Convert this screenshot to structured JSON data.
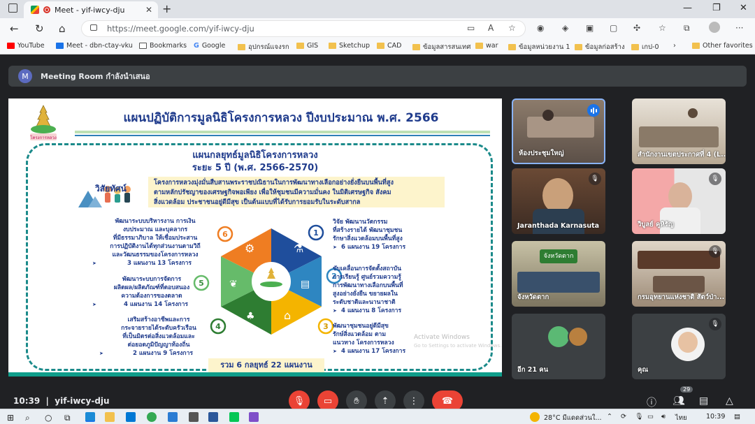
{
  "browser": {
    "tab_title": "Meet - yif-iwcy-dju",
    "new_tab": "+",
    "url": "https://meet.google.com/yif-iwcy-dju",
    "window_controls": [
      "—",
      "❐",
      "✕"
    ]
  },
  "bookmarks": [
    {
      "label": "YouTube",
      "kind": "youtube"
    },
    {
      "label": "Meet - dbn-ctay-vku",
      "kind": "meet"
    },
    {
      "label": "Bookmarks",
      "kind": "page"
    },
    {
      "label": "Google",
      "kind": "google"
    },
    {
      "label": "อุปกรณ์แจงรก",
      "kind": "folder"
    },
    {
      "label": "GIS",
      "kind": "folder"
    },
    {
      "label": "Sketchup",
      "kind": "folder"
    },
    {
      "label": "CAD",
      "kind": "folder"
    },
    {
      "label": "ข้อมูลสารสนเทศ",
      "kind": "folder"
    },
    {
      "label": "war",
      "kind": "folder"
    },
    {
      "label": "ข้อมูลหน่วยงาน 1",
      "kind": "folder"
    },
    {
      "label": "ข้อมูลก่อสร้าง",
      "kind": "folder"
    },
    {
      "label": "เกป-0",
      "kind": "folder"
    },
    {
      "label": "Other favorites",
      "kind": "folder"
    }
  ],
  "meeting": {
    "room_avatar": "M",
    "room_title": "Meeting Room กำลังนำเสนอ",
    "time": "10:39",
    "code": "yif-iwcy-dju",
    "participants_count": "29"
  },
  "slide": {
    "title": "แผนปฏิบัติการมูลนิธิโครงการหลวง ปีงบประมาณ พ.ศ. 2566",
    "logo_text": "โครงการหลวง",
    "subtitle1": "แผนกลยุทธ์มูลนิธิโครงการหลวง",
    "subtitle2": "ระยะ 5 ปี (พ.ศ. 2566-2570)",
    "vision_label": "วิสัยทัศน์",
    "vision_lines": [
      "โครงการหลวงมุ่งมั่นสืบสานพระราชปณิธานในการพัฒนาทางเลือกอย่างยั่งยืนบนพื้นที่สูง",
      "ตามหลักปรัชญาของเศรษฐกิจพอเพียง เพื่อให้ชุมชนมีความมั่นคง ในมิติเศรษฐกิจ สังคม",
      "สิ่งแวดล้อม ประชาชนอยู่ดีมีสุข เป็นต้นแบบที่ได้รับการยอมรับในระดับสากล"
    ],
    "strategies": [
      {
        "num": "1",
        "lines": [
          "วิจัย พัฒนานวัตกรรม",
          "ที่สร้างรายได้ พัฒนาชุมชน",
          "รักษาสิ่งแวดล้อมบนพื้นที่สูง"
        ],
        "note": "6 แผนงาน 19 โครงการ"
      },
      {
        "num": "2",
        "lines": [
          "ขับเคลื่อนการจัดตั้งสถาบัน",
          "การเรียนรู้ ศูนย์รวมความรู้",
          "การพัฒนาทางเลือกบนพื้นที่",
          "สูงอย่างยั่งยืน ขยายผลใน",
          "ระดับชาติและนานาชาติ"
        ],
        "note": "4 แผนงาน 8 โครงการ"
      },
      {
        "num": "3",
        "lines": [
          "พัฒนาชุมชนอยู่ดีมีสุข",
          "รักษ์สิ่งแวดล้อม ตาม",
          "แนวทาง โครงการหลวง"
        ],
        "note": "4 แผนงาน 17 โครงการ"
      },
      {
        "num": "4",
        "lines": [
          "เสริมสร้างอาชีพและการ",
          "กระจายรายได้ระดับครัวเรือน",
          "ที่เป็นมิตรต่อสิ่งแวดล้อมและ",
          "ต่อยอดภูมิปัญญาท้องถิ่น"
        ],
        "note": "2 แผนงาน 9 โครงการ"
      },
      {
        "num": "5",
        "lines": [
          "พัฒนาระบบการจัดการ",
          "ผลิตผล/ผลิตภัณฑ์ที่ตอบสนอง",
          "ความต้องการของตลาด"
        ],
        "note": "4 แผนงาน 14 โครงการ"
      },
      {
        "num": "6",
        "lines": [
          "พัฒนาระบบบริหารงาน การเงิน",
          "งบประมาณ และบุคลากร",
          "ที่มีธรรมาภิบาล ให้เชื่อมประสาน",
          "การปฏิบัติงานได้ทุกส่วนงานตามวิถี",
          "และวัฒนธรรมของโครงการหลวง"
        ],
        "note": "3 แผนงาน 13 โครงการ"
      }
    ],
    "total": "รวม 6 กลยุทธ์ 22 แผนงาน",
    "watermark1": "Activate Windows",
    "watermark2": "Go to Settings to activate Windows."
  },
  "tiles": [
    {
      "name": "ห้องประชุมใหญ่",
      "speaking": true
    },
    {
      "name": "สำนักงานเขตประกาศที่ 4 (L..",
      "muted": false
    },
    {
      "name": "Jaranthada Karnasuta",
      "muted": true
    },
    {
      "name": "วิบูลย์ คูหิรัญ",
      "muted": true
    },
    {
      "name": "จังหวัดตาก",
      "muted": false,
      "sign": "จังหวัดตาก"
    },
    {
      "name": "กรมอุทยานแห่งชาติ สัตว์ป่า...",
      "muted": true
    },
    {
      "name": "อีก 21 คน",
      "muted": false
    },
    {
      "name": "คุณ",
      "muted": true
    }
  ],
  "taskbar": {
    "weather": "28°C  มีแดดส่วนใ...",
    "language": "ไทย",
    "clock": "10:39"
  },
  "colors": {
    "meet_bg": "#202124",
    "tile_bg": "#3c4043",
    "hangup": "#ea4335",
    "slide_title": "#1f3b8c",
    "frame": "#1b8a8a"
  }
}
